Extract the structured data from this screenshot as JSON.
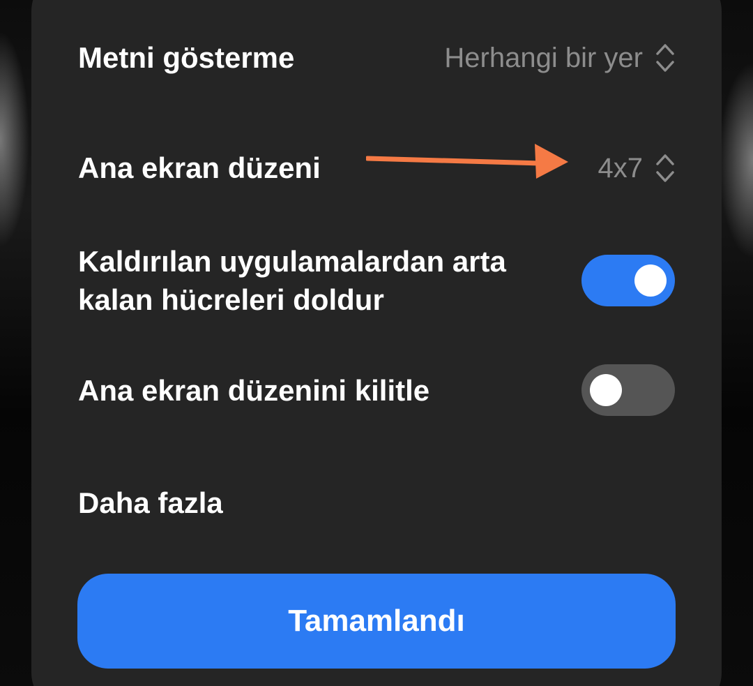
{
  "settings": {
    "text_display": {
      "label": "Metni gösterme",
      "value": "Herhangi bir yer"
    },
    "home_layout": {
      "label": "Ana ekran düzeni",
      "value": "4x7"
    },
    "fill_cells": {
      "label_line1": "Kaldırılan uygulamalardan arta",
      "label_line2": "kalan hücreleri doldur",
      "enabled": true
    },
    "lock_layout": {
      "label": "Ana ekran düzenini kilitle",
      "enabled": false
    },
    "more": {
      "label": "Daha fazla"
    }
  },
  "done_button": {
    "label": "Tamamlandı"
  },
  "colors": {
    "accent": "#2c7bf3",
    "sheet": "#252525",
    "annotation_arrow": "#f57a45",
    "toggle_off": "#555555"
  },
  "icons": {
    "selector": "chevron-up-down-icon",
    "annotation": "arrow-right-icon"
  }
}
